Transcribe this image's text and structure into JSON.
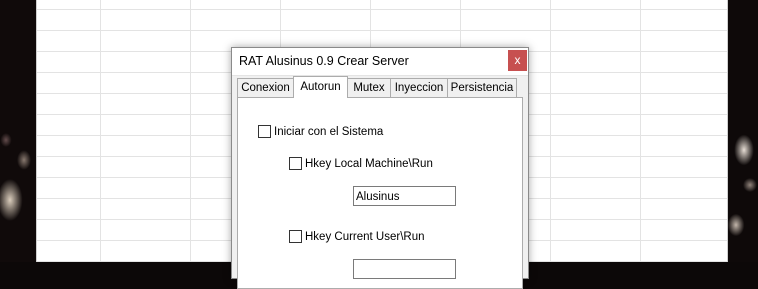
{
  "dialog": {
    "title": "RAT Alusinus 0.9 Crear Server",
    "close_glyph": "x"
  },
  "tabs": [
    {
      "label": "Conexion",
      "active": false
    },
    {
      "label": "Autorun",
      "active": true
    },
    {
      "label": "Mutex",
      "active": false
    },
    {
      "label": "Inyeccion",
      "active": false
    },
    {
      "label": "Persistencia",
      "active": false
    }
  ],
  "autorun": {
    "start_with_system_label": "Iniciar con el Sistema",
    "start_with_system_checked": false,
    "hklm_label": "Hkey Local Machine\\Run",
    "hklm_checked": false,
    "hklm_value": "Alusinus",
    "hkcu_label": "Hkey Current User\\Run",
    "hkcu_checked": false,
    "hkcu_value": ""
  },
  "colors": {
    "close_button": "#c75050",
    "dialog_bg": "#f0f0f0"
  }
}
